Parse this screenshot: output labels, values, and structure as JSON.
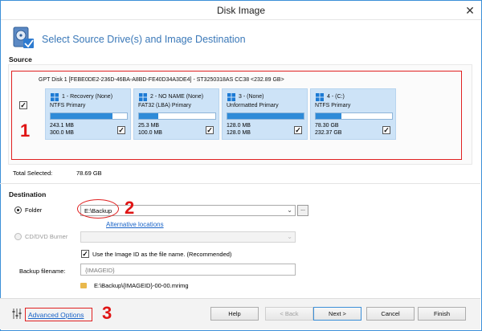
{
  "window": {
    "title": "Disk Image"
  },
  "header": {
    "title": "Select Source Drive(s) and Image Destination"
  },
  "source": {
    "label": "Source",
    "disk_caption": "GPT Disk 1 [FEBE0DE2-236D-46BA-A8BD-FE40D34A3DE4] - ST3250318AS CC38  <232.89 GB>",
    "partitions": [
      {
        "name": "1 - Recovery (None)",
        "type": "NTFS Primary",
        "used": "243.1 MB",
        "total": "300.0 MB",
        "fill": 0.81
      },
      {
        "name": "2 - NO NAME (None)",
        "type": "FAT32 (LBA) Primary",
        "used": "25.3 MB",
        "total": "100.0 MB",
        "fill": 0.25
      },
      {
        "name": "3 -  (None)",
        "type": "Unformatted Primary",
        "used": "128.0 MB",
        "total": "128.0 MB",
        "fill": 1.0
      },
      {
        "name": "4 -  (C:)",
        "type": "NTFS Primary",
        "used": "78.30 GB",
        "total": "232.37 GB",
        "fill": 0.34
      }
    ],
    "total_selected_label": "Total Selected:",
    "total_selected_value": "78.69 GB"
  },
  "destination": {
    "label": "Destination",
    "folder_label": "Folder",
    "folder_value": "E:\\Backup",
    "browse_label": "...",
    "alternative_locations": "Alternative locations",
    "cddvd_label": "CD/DVD Burner",
    "use_image_id_label": "Use the Image ID as the file name.  (Recommended)",
    "backup_filename_label": "Backup filename:",
    "backup_filename_value": "{IMAGEID}",
    "output_path": "E:\\Backup\\{IMAGEID}-00-00.mrimg"
  },
  "footer": {
    "advanced_options": "Advanced Options",
    "help": "Help",
    "back": "< Back",
    "next": "Next >",
    "cancel": "Cancel",
    "finish": "Finish"
  },
  "annotations": {
    "n1": "1",
    "n2": "2",
    "n3": "3"
  },
  "colors": {
    "accent": "#3a78b8",
    "annotation_red": "#e01515",
    "partition_fill": "#2e8bd8",
    "partition_bg": "#cde3f7"
  }
}
